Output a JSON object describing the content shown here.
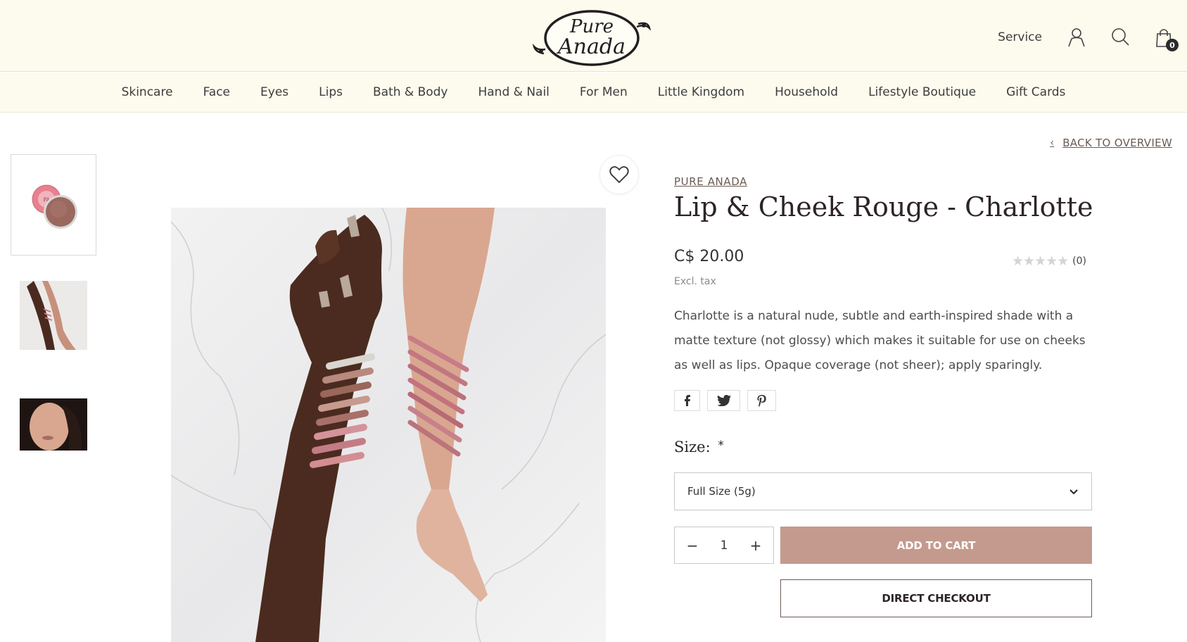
{
  "header": {
    "logo_text_line1": "Pure",
    "logo_text_line2": "Anada",
    "service_label": "Service",
    "cart_count": "0"
  },
  "nav": {
    "items": [
      {
        "label": "Skincare"
      },
      {
        "label": "Face"
      },
      {
        "label": "Eyes"
      },
      {
        "label": "Lips"
      },
      {
        "label": "Bath & Body"
      },
      {
        "label": "Hand & Nail"
      },
      {
        "label": "For Men"
      },
      {
        "label": "Little Kingdom"
      },
      {
        "label": "Household"
      },
      {
        "label": "Lifestyle Boutique"
      },
      {
        "label": "Gift Cards"
      }
    ]
  },
  "product": {
    "back_label": "BACK TO OVERVIEW",
    "brand": "PURE ANADA",
    "title": "Lip & Cheek Rouge - Charlotte",
    "price": "C$ 20.00",
    "tax_note": "Excl. tax",
    "rating_count": "(0)",
    "rating_value": 0,
    "description": "Charlotte is a natural nude, subtle and earth-inspired shade with a matte texture (not glossy) which makes it suitable for use on cheeks as well as lips. Opaque coverage (not sheer); apply sparingly.",
    "size_label": "Size:",
    "size_required_mark": "*",
    "size_selected": "Full Size (5g)",
    "quantity": "1",
    "add_to_cart_label": "ADD TO CART",
    "direct_checkout_label": "DIRECT CHECKOUT"
  },
  "colors": {
    "header_bg": "#fdfbee",
    "accent_button": "#c59a8e",
    "link": "#6b5a52"
  },
  "icons": {
    "account": "user-icon",
    "search": "search-icon",
    "cart": "shopping-bag-icon",
    "wishlist": "heart-icon",
    "back": "chevron-left-icon",
    "dropdown": "chevron-down-icon",
    "share": [
      "facebook-icon",
      "twitter-icon",
      "pinterest-icon"
    ]
  }
}
